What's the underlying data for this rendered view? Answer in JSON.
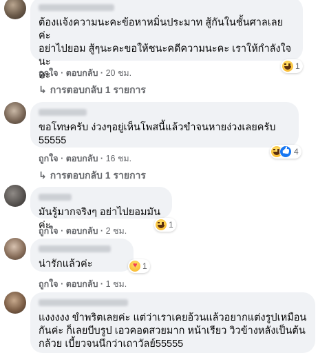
{
  "comments": [
    {
      "text": "ต้องแจ้งความนะคะข้อหาหมิ่นประมาท สู้กันในชั้นศาลเลยค่ะ\nอย่าไปยอม สู้ๆนะคะขอให้ชนะคดีความนะคะ เราให้กำลังใจนะ\nคะ",
      "like": "ถูกใจ",
      "reply": "ตอบกลับ",
      "time": "20 ชม.",
      "reaction_count": "1",
      "replies": "การตอบกลับ 1 รายการ"
    },
    {
      "text": "ขอโทษครับ ง่วงๆอยู่เห็นโพสนี้แล้วขำจนหายง่วงเลยครับ\n55555",
      "like": "ถูกใจ",
      "reply": "ตอบกลับ",
      "time": "16 ชม.",
      "reaction_count": "4",
      "replies": "การตอบกลับ 1 รายการ"
    },
    {
      "text": "มันรู้มากจริงๆ อย่าไปยอมมันค่ะ",
      "like": "ถูกใจ",
      "reply": "ตอบกลับ",
      "time": "2 ชม.",
      "reaction_count": "1"
    },
    {
      "text": "น่ารักแล้วค่ะ",
      "like": "ถูกใจ",
      "reply": "ตอบกลับ",
      "time": "1 ชม.",
      "reaction_count": "1"
    },
    {
      "text": "แงงงงง ขำพริตเลยค่ะ แต่ว่าเราเคยอ้วนแล้วอยากแต่งรูปเหมือน\nกันค่ะ ก็เลยบีบรูป เอวคอดสวยมาก หน้าเรียว วิวข้างหลังเป็นต้น\nกล้วย เบี้ยวจนนึกว่าเถาวัลย์55555"
    }
  ],
  "icons": {
    "reaction_haha": "haha-emoji-icon",
    "reaction_like": "like-icon",
    "reaction_love": "care-emoji-icon",
    "reply_arrow": "reply-arrow-icon"
  },
  "colors": {
    "bubble": "#f0f2f5",
    "secondary_text": "#65676b",
    "like_blue": "#1877f2"
  }
}
